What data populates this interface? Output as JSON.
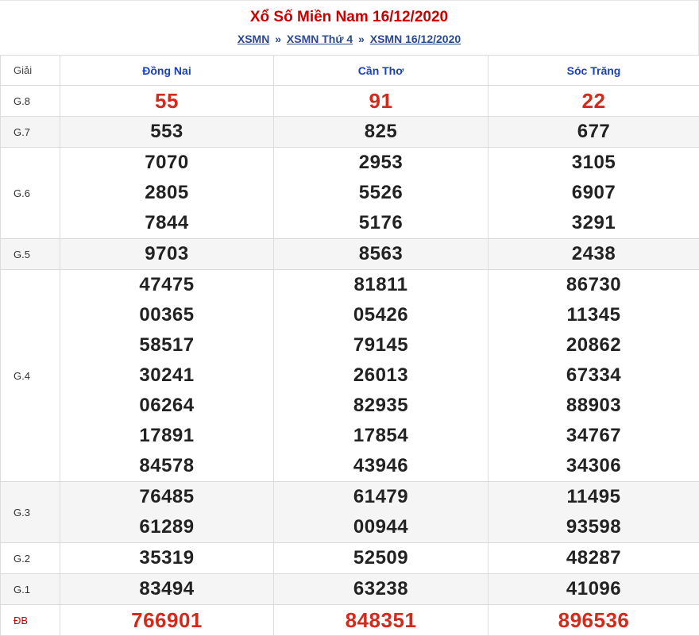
{
  "header": {
    "title": "Xổ Số Miền Nam 16/12/2020",
    "breadcrumb": [
      "XSMN",
      "XSMN Thứ 4",
      "XSMN 16/12/2020"
    ],
    "separator": "»"
  },
  "table": {
    "label_header": "Giải",
    "provinces": [
      "Đồng Nai",
      "Cần Thơ",
      "Sóc Trăng"
    ],
    "rows": [
      {
        "label": "G.8",
        "values": [
          [
            "55"
          ],
          [
            "91"
          ],
          [
            "22"
          ]
        ]
      },
      {
        "label": "G.7",
        "values": [
          [
            "553"
          ],
          [
            "825"
          ],
          [
            "677"
          ]
        ]
      },
      {
        "label": "G.6",
        "values": [
          [
            "7070",
            "2805",
            "7844"
          ],
          [
            "2953",
            "5526",
            "5176"
          ],
          [
            "3105",
            "6907",
            "3291"
          ]
        ]
      },
      {
        "label": "G.5",
        "values": [
          [
            "9703"
          ],
          [
            "8563"
          ],
          [
            "2438"
          ]
        ]
      },
      {
        "label": "G.4",
        "values": [
          [
            "47475",
            "00365",
            "58517",
            "30241",
            "06264",
            "17891",
            "84578"
          ],
          [
            "81811",
            "05426",
            "79145",
            "26013",
            "82935",
            "17854",
            "43946"
          ],
          [
            "86730",
            "11345",
            "20862",
            "67334",
            "88903",
            "34767",
            "34306"
          ]
        ]
      },
      {
        "label": "G.3",
        "values": [
          [
            "76485",
            "61289"
          ],
          [
            "61479",
            "00944"
          ],
          [
            "11495",
            "93598"
          ]
        ]
      },
      {
        "label": "G.2",
        "values": [
          [
            "35319"
          ],
          [
            "52509"
          ],
          [
            "48287"
          ]
        ]
      },
      {
        "label": "G.1",
        "values": [
          [
            "83494"
          ],
          [
            "63238"
          ],
          [
            "41096"
          ]
        ]
      },
      {
        "label": "ĐB",
        "values": [
          [
            "766901"
          ],
          [
            "848351"
          ],
          [
            "896536"
          ]
        ]
      }
    ]
  },
  "colors": {
    "title": "#c80000",
    "province": "#1a3ec8",
    "highlight": "#d42a1c",
    "link": "#2a4a8f"
  }
}
